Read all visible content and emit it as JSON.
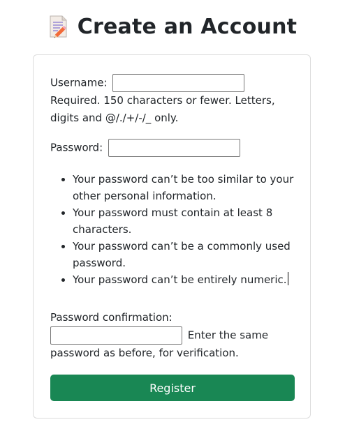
{
  "header": {
    "title": "Create an Account",
    "icon": "memo-icon"
  },
  "form": {
    "username": {
      "label": "Username:",
      "value": "",
      "help": "Required. 150 characters or fewer. Letters, digits and @/./+/-/_ only."
    },
    "password": {
      "label": "Password:",
      "value": ""
    },
    "password_rules": [
      "Your password can’t be too similar to your other personal information.",
      "Your password must contain at least 8 characters.",
      "Your password can’t be a commonly used password.",
      "Your password can’t be entirely numeric."
    ],
    "password_confirmation": {
      "label": "Password confirmation:",
      "value": "",
      "help": "Enter the same password as before, for verification."
    },
    "submit_label": "Register"
  },
  "colors": {
    "primary_button": "#198754",
    "card_border": "#dcdcdc",
    "text": "#212529"
  }
}
